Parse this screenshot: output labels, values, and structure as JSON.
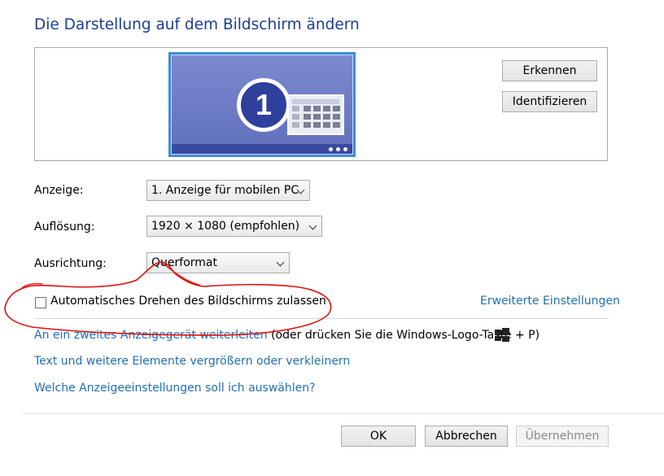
{
  "header": {
    "title": "Die Darstellung auf dem Bildschirm ändern"
  },
  "preview": {
    "monitor_number": "1",
    "detect_label": "Erkennen",
    "identify_label": "Identifizieren"
  },
  "settings": {
    "display_label": "Anzeige:",
    "display_value": "1. Anzeige für mobilen PC",
    "resolution_label": "Auflösung:",
    "resolution_value": "1920 × 1080 (empfohlen)",
    "orientation_label": "Ausrichtung:",
    "orientation_value": "Querformat"
  },
  "auto_rotate": {
    "label": "Automatisches Drehen des Bildschirms zulassen",
    "checked": false
  },
  "advanced_link": "Erweiterte Einstellungen",
  "links": {
    "project_link": "An ein zweites Anzeigegerät weiterleiten",
    "project_hint_pre": "(oder drücken Sie die Windows-Logo-Taste",
    "project_hint_post": "+ P)",
    "resize_link": "Text und weitere Elemente vergrößern oder verkleinern",
    "help_link": "Welche Anzeigeeinstellungen soll ich auswählen?"
  },
  "footer": {
    "ok_label": "OK",
    "cancel_label": "Abbrechen",
    "apply_label": "Übernehmen"
  },
  "colors": {
    "title": "#1c3d94",
    "link": "#1f6fb3",
    "annotation": "#e01010"
  },
  "icons": [
    "windows-logo-icon",
    "chevron-down-icon",
    "grid-icon"
  ]
}
